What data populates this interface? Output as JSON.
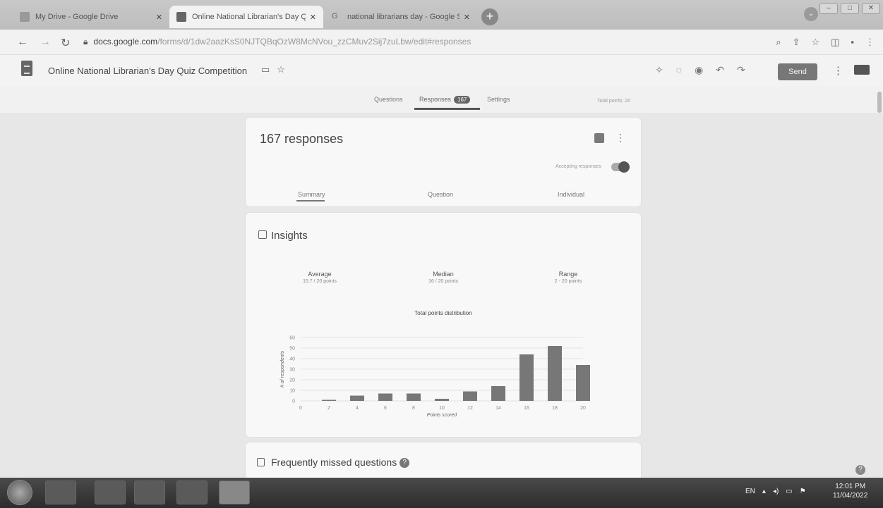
{
  "browser": {
    "tabs": [
      {
        "label": "My Drive - Google Drive",
        "active": false
      },
      {
        "label": "Online National Librarian's Day Q",
        "active": true
      },
      {
        "label": "national librarians day - Google S",
        "active": false
      }
    ],
    "new_tab": "+",
    "url_host": "docs.google.com",
    "url_path": "/forms/d/1dw2aazKsS0NJTQBqOzW8McNVou_zzCMuv2Sij7zuLbw/edit#responses"
  },
  "forms": {
    "title": "Online National Librarian's Day Quiz Competition",
    "send_label": "Send",
    "tabs": {
      "questions": "Questions",
      "responses": "Responses",
      "responses_count": "167",
      "settings": "Settings"
    },
    "total_points": "Total points: 20"
  },
  "responses_card": {
    "title": "167 responses",
    "accepting_label": "Accepting responses",
    "subtabs": {
      "summary": "Summary",
      "question": "Question",
      "individual": "Individual"
    }
  },
  "insights": {
    "title": "Insights",
    "average_label": "Average",
    "average_value": "15.7 / 20 points",
    "median_label": "Median",
    "median_value": "16 / 20 points",
    "range_label": "Range",
    "range_value": "2 - 20 points"
  },
  "chart_data": {
    "type": "bar",
    "title": "Total points distribution",
    "xlabel": "Points scored",
    "ylabel": "# of respondents",
    "x_ticks": [
      "0",
      "2",
      "4",
      "6",
      "8",
      "10",
      "12",
      "14",
      "16",
      "18",
      "20"
    ],
    "y_ticks": [
      "0",
      "10",
      "20",
      "30",
      "40",
      "50",
      "60"
    ],
    "ylim": [
      0,
      60
    ],
    "categories": [
      "2",
      "4",
      "6",
      "8",
      "10",
      "12",
      "14",
      "16",
      "18",
      "20"
    ],
    "values": [
      1,
      5,
      7,
      7,
      2,
      9,
      14,
      44,
      52,
      34
    ],
    "bar_color": "#777777"
  },
  "missed": {
    "title": "Frequently missed questions",
    "help": "?"
  },
  "taskbar": {
    "lang": "EN",
    "time": "12:01 PM",
    "date": "11/04/2022"
  }
}
